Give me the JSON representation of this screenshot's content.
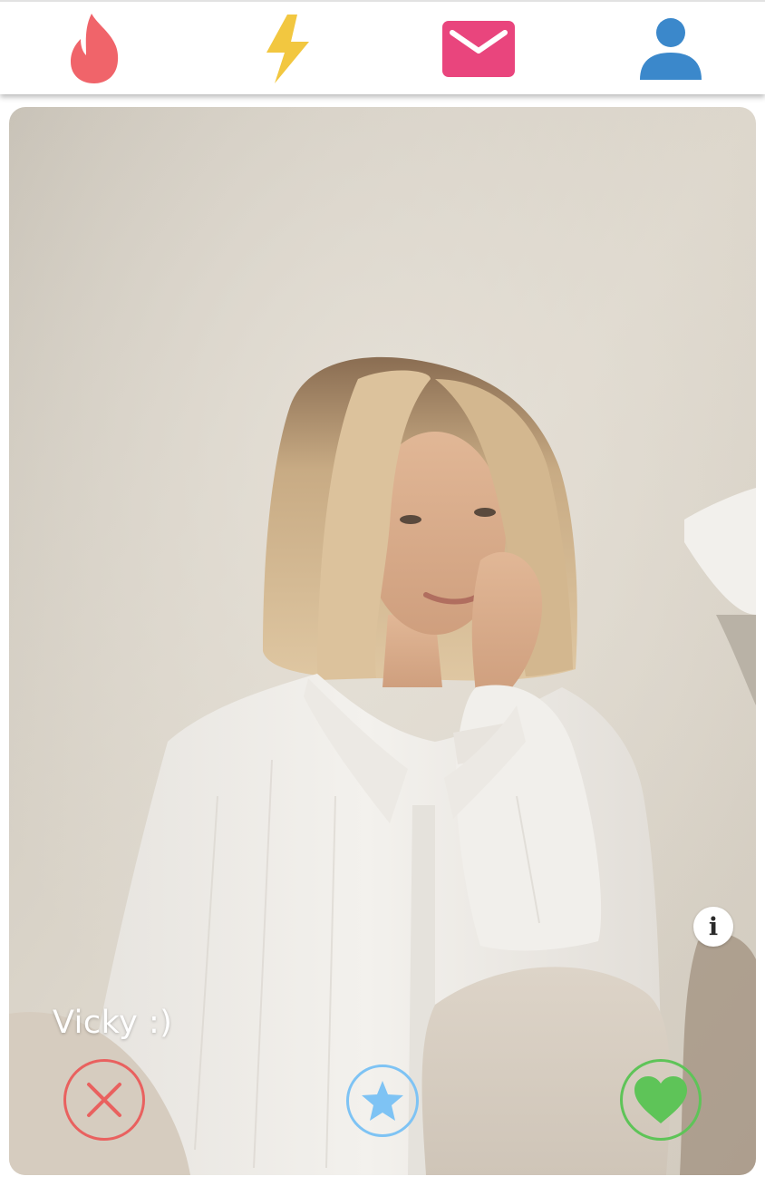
{
  "nav": {
    "items": [
      {
        "icon": "flame-icon",
        "color": "#f0646a"
      },
      {
        "icon": "lightning-icon",
        "color": "#f2c740"
      },
      {
        "icon": "mail-icon",
        "color": "#e9457d"
      },
      {
        "icon": "user-icon",
        "color": "#3b88cb"
      }
    ]
  },
  "profile": {
    "name": "Vicky :)",
    "info_icon": "i"
  },
  "actions": {
    "nope": {
      "icon": "close-icon",
      "color": "#e9615f"
    },
    "super_like": {
      "icon": "star-icon",
      "color": "#7ec3f4"
    },
    "like": {
      "icon": "heart-icon",
      "color": "#5ec458"
    }
  }
}
